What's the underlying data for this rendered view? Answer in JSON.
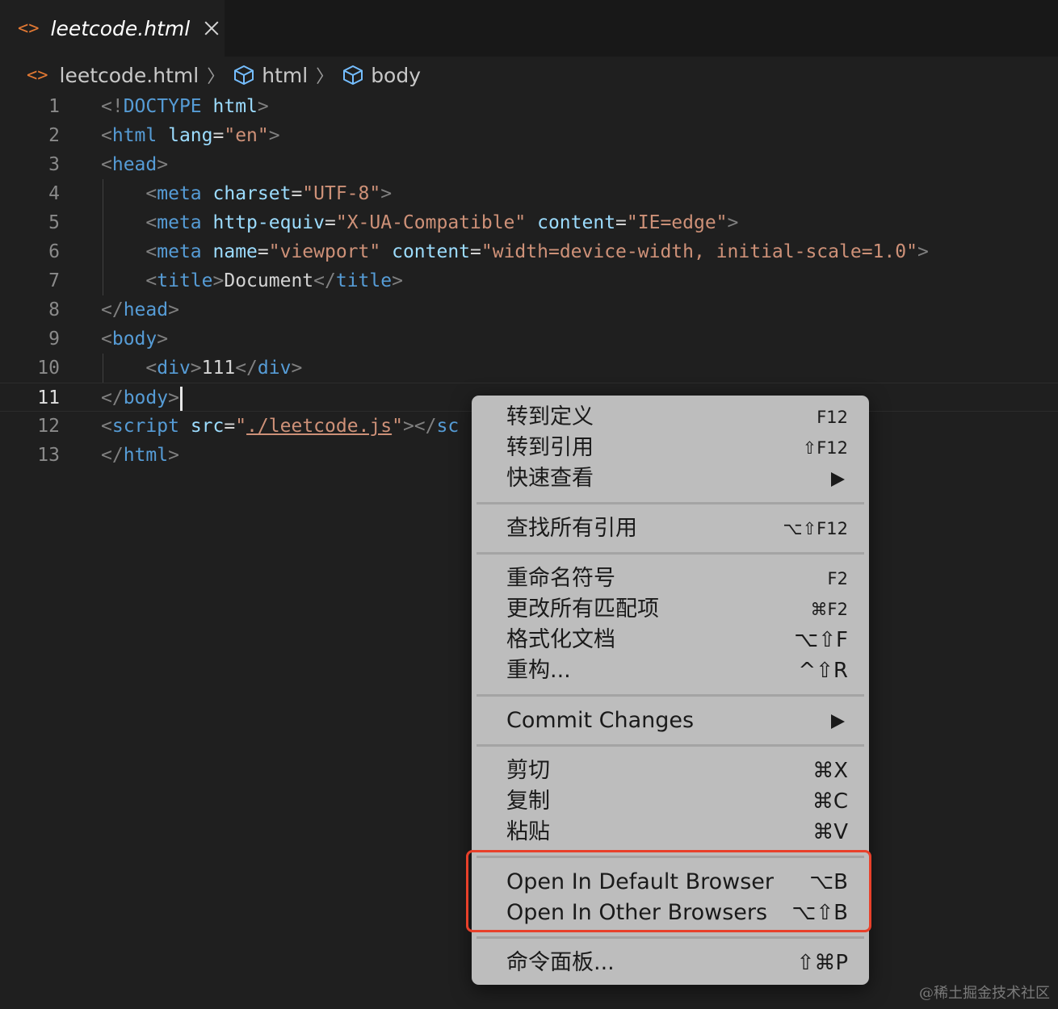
{
  "tab": {
    "label": "leetcode.html",
    "icon": "html-file-icon"
  },
  "breadcrumb": {
    "file": "leetcode.html",
    "items": [
      "html",
      "body"
    ]
  },
  "editor": {
    "active_line": 11,
    "lines": [
      {
        "n": "1"
      },
      {
        "n": "2"
      },
      {
        "n": "3"
      },
      {
        "n": "4"
      },
      {
        "n": "5"
      },
      {
        "n": "6"
      },
      {
        "n": "7"
      },
      {
        "n": "8"
      },
      {
        "n": "9"
      },
      {
        "n": "10"
      },
      {
        "n": "11"
      },
      {
        "n": "12"
      },
      {
        "n": "13"
      }
    ],
    "code": {
      "l1": [
        "<!",
        "DOCTYPE",
        " ",
        "html",
        ">"
      ],
      "l2": [
        "<",
        "html",
        " ",
        "lang",
        "=",
        "\"en\"",
        ">"
      ],
      "l3": [
        "<",
        "head",
        ">"
      ],
      "l4": [
        "    <",
        "meta",
        " ",
        "charset",
        "=",
        "\"UTF-8\"",
        ">"
      ],
      "l5": [
        "    <",
        "meta",
        " ",
        "http-equiv",
        "=",
        "\"X-UA-Compatible\"",
        " ",
        "content",
        "=",
        "\"IE=edge\"",
        ">"
      ],
      "l6": [
        "    <",
        "meta",
        " ",
        "name",
        "=",
        "\"viewport\"",
        " ",
        "content",
        "=",
        "\"width=device-width, initial-scale=1.0\"",
        ">"
      ],
      "l7": [
        "    <",
        "title",
        ">",
        "Document",
        "</",
        "title",
        ">"
      ],
      "l8": [
        "</",
        "head",
        ">"
      ],
      "l9": [
        "<",
        "body",
        ">"
      ],
      "l10": [
        "    <",
        "div",
        ">",
        "111",
        "</",
        "div",
        ">"
      ],
      "l11": [
        "</",
        "body",
        ">"
      ],
      "l12": [
        "<",
        "script",
        " ",
        "src",
        "=",
        "\"",
        "./leetcode.js",
        "\"",
        "></",
        "sc"
      ],
      "l13": [
        "</",
        "html",
        ">"
      ]
    }
  },
  "context_menu": {
    "groups": [
      [
        {
          "label": "转到定义",
          "shortcut": "F12"
        },
        {
          "label": "转到引用",
          "shortcut": "⇧F12"
        },
        {
          "label": "快速查看",
          "submenu": true
        }
      ],
      [
        {
          "label": "查找所有引用",
          "shortcut": "⌥⇧F12"
        }
      ],
      [
        {
          "label": "重命名符号",
          "shortcut": "F2"
        },
        {
          "label": "更改所有匹配项",
          "shortcut": "⌘F2"
        },
        {
          "label": "格式化文档",
          "shortcut": "⌥⇧F"
        },
        {
          "label": "重构...",
          "shortcut": "^⇧R"
        }
      ],
      [
        {
          "label": "Commit Changes",
          "submenu": true
        }
      ],
      [
        {
          "label": "剪切",
          "shortcut": "⌘X"
        },
        {
          "label": "复制",
          "shortcut": "⌘C"
        },
        {
          "label": "粘贴",
          "shortcut": "⌘V"
        }
      ],
      [
        {
          "label": "Open In Default Browser",
          "shortcut": "⌥B"
        },
        {
          "label": "Open In Other Browsers",
          "shortcut": "⌥⇧B"
        }
      ],
      [
        {
          "label": "命令面板...",
          "shortcut": "⇧⌘P"
        }
      ]
    ],
    "highlight_color": "#e8402a"
  },
  "watermark": "@稀土掘金技术社区"
}
